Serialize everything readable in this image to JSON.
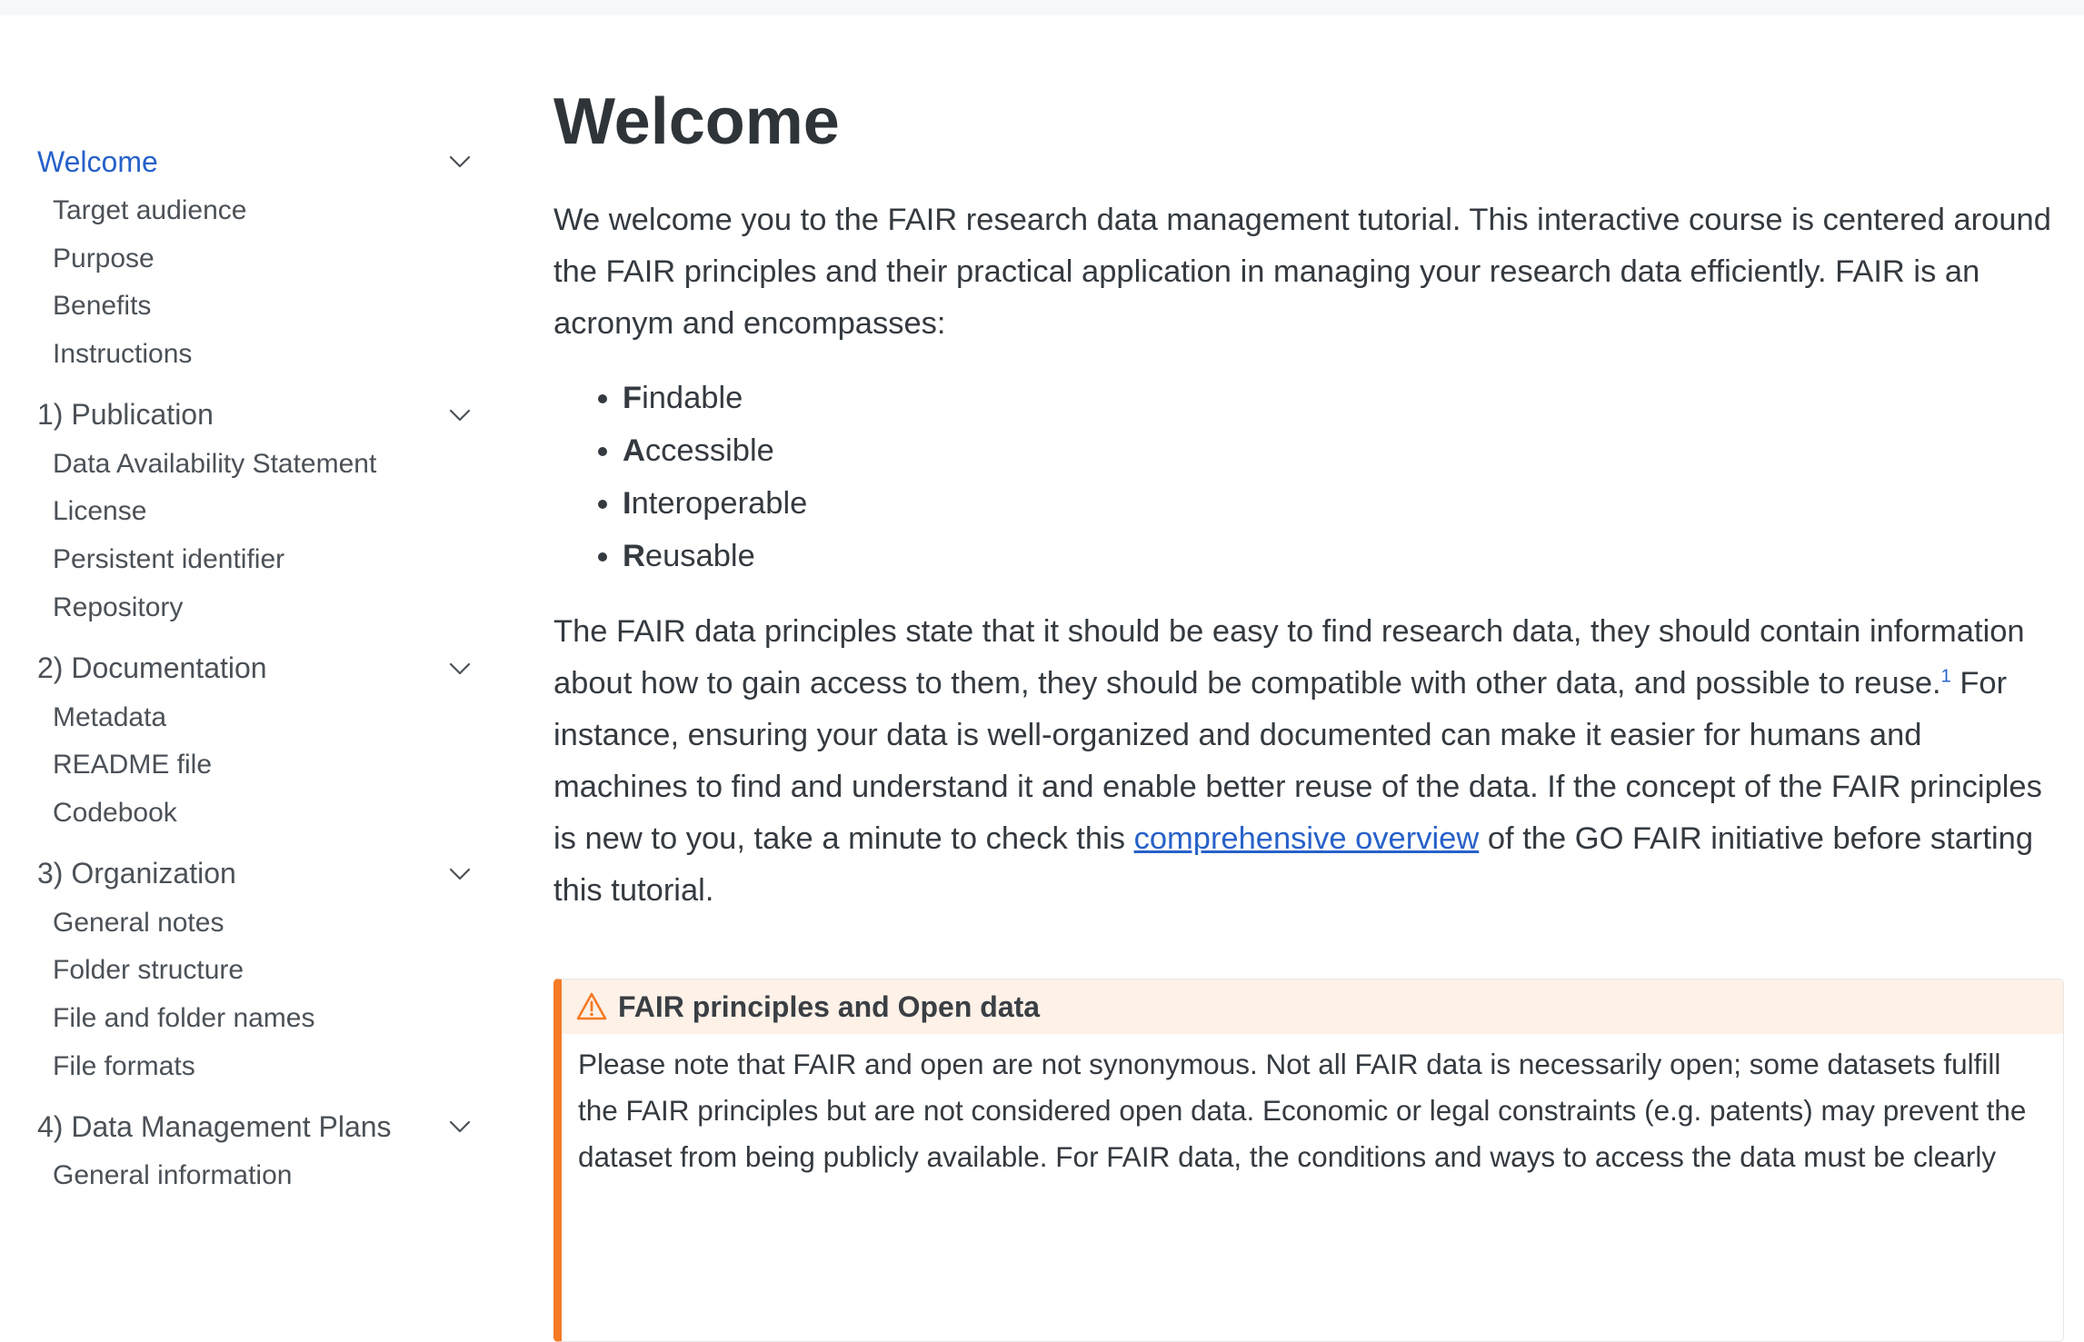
{
  "sidebar": {
    "sections": [
      {
        "label": "Welcome",
        "active": true,
        "items": [
          "Target audience",
          "Purpose",
          "Benefits",
          "Instructions"
        ]
      },
      {
        "label": "1) Publication",
        "active": false,
        "items": [
          "Data Availability Statement",
          "License",
          "Persistent identifier",
          "Repository"
        ]
      },
      {
        "label": "2) Documentation",
        "active": false,
        "items": [
          "Metadata",
          "README file",
          "Codebook"
        ]
      },
      {
        "label": "3) Organization",
        "active": false,
        "items": [
          "General notes",
          "Folder structure",
          "File and folder names",
          "File formats"
        ]
      },
      {
        "label": "4) Data Management Plans",
        "active": false,
        "items": [
          "General information"
        ]
      }
    ],
    "chevron_icon": "chevron-down-icon"
  },
  "main": {
    "title": "Welcome",
    "intro": "We welcome you to the FAIR research data management tutorial. This interactive course is centered around the FAIR principles and their practical application in managing your research data efficiently. FAIR is an acronym and encompasses:",
    "fair_list": [
      {
        "initial": "F",
        "rest": "indable"
      },
      {
        "initial": "A",
        "rest": "ccessible"
      },
      {
        "initial": "I",
        "rest": "nteroperable"
      },
      {
        "initial": "R",
        "rest": "eusable"
      }
    ],
    "p2_part1": "The FAIR data principles state that it should be easy to find research data, they should contain information about how to gain access to them, they should be compatible with other data, and possible to reuse.",
    "p2_footnote": "1",
    "p2_part2": " For instance, ensuring your data is well-organized and documented can make it easier for humans and machines to find and understand it and enable better reuse of the data. If the concept of the FAIR principles is new to you, take a minute to check this ",
    "p2_link": "comprehensive overview",
    "p2_part3": " of the GO FAIR initiative before starting this tutorial.",
    "callout": {
      "icon": "warning-icon",
      "title": "FAIR principles and Open data",
      "body": "Please note that FAIR and open are not synonymous. Not all FAIR data is necessarily open; some datasets fulfill the FAIR principles but are not considered open data. Economic or legal constraints (e.g. patents) may prevent the dataset from being publicly available. For FAIR data, the conditions and ways to access the data must be clearly"
    }
  },
  "colors": {
    "link": "#2761c9",
    "accent_warning": "#f47a24",
    "callout_bg": "#fdf1e8"
  }
}
